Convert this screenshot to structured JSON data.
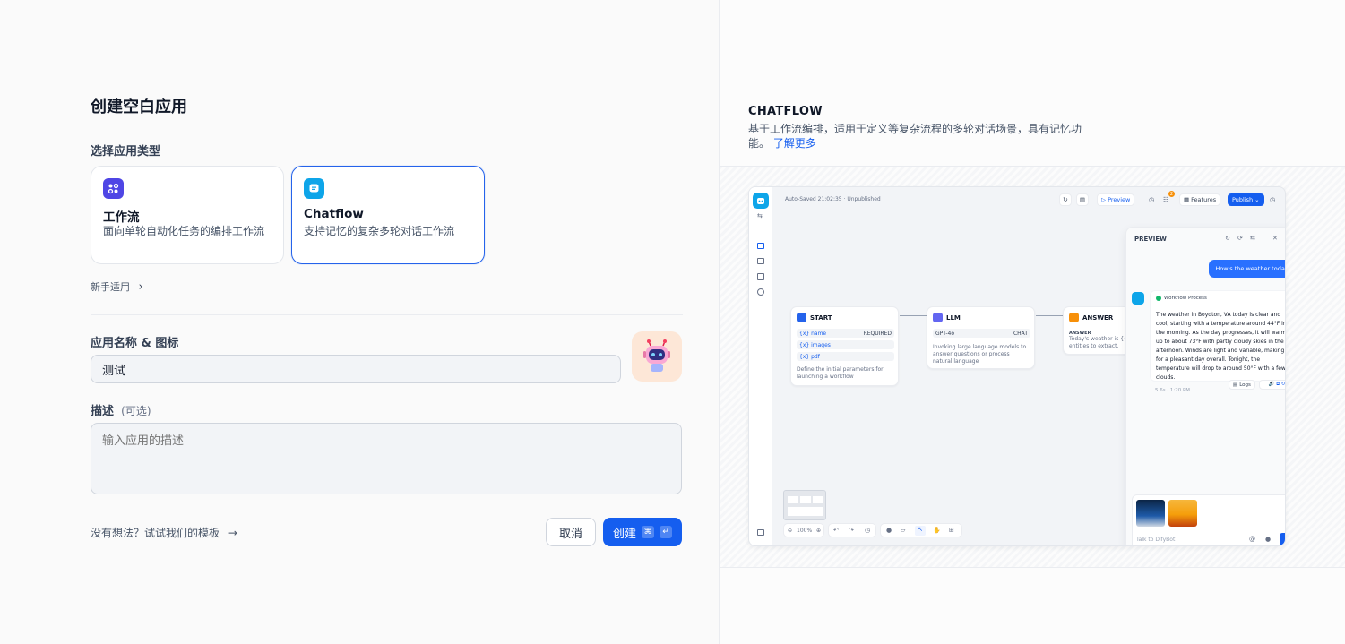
{
  "form": {
    "title": "创建空白应用",
    "type_label": "选择应用类型",
    "types": [
      {
        "name": "工作流",
        "desc": "面向单轮自动化任务的编排工作流",
        "icon": "workflow-icon",
        "color": "#4f46e5"
      },
      {
        "name": "Chatflow",
        "desc": "支持记忆的复杂多轮对话工作流",
        "icon": "chatflow-icon",
        "color": "#0ea5e9"
      }
    ],
    "newbie": "新手适用",
    "name_label": "应用名称 & 图标",
    "name_value": "测试",
    "desc_label": "描述",
    "desc_optional": "(可选)",
    "desc_placeholder": "输入应用的描述",
    "template_link": "没有想法？试试我们的模板",
    "cancel": "取消",
    "create": "创建",
    "kbd_cmd": "⌘",
    "kbd_enter": "↵"
  },
  "preview": {
    "title": "CHATFLOW",
    "desc": "基于工作流编排，适用于定义等复杂流程的多轮对话场景，具有记忆功能。",
    "learn_more": "了解更多",
    "canvas": {
      "autosave": "Auto-Saved 21:02:35 · Unpublished",
      "preview_btn": "▷ Preview",
      "features": "Features",
      "publish": "Publish",
      "badge": "2",
      "zoom": "100%",
      "start": {
        "title": "START",
        "rows": [
          {
            "k": "{x} name",
            "v": "REQUIRED"
          },
          {
            "k": "{x} images",
            "v": ""
          },
          {
            "k": "{x} pdf",
            "v": ""
          }
        ],
        "desc": "Define the initial parameters for launching a workflow"
      },
      "llm": {
        "title": "LLM",
        "model": "GPT-4o",
        "tag": "CHAT",
        "desc": "Invoking large language models to answer questions or process natural language"
      },
      "answer": {
        "title": "ANSWER",
        "sub": "ANSWER",
        "text": "Today's weather is {{w",
        "text2": "entities to extract."
      },
      "chat": {
        "title": "PREVIEW",
        "user_msg": "How's the weather today",
        "wf_label": "Workflow Process",
        "reply": "The weather in Boydton, VA today is clear and cool, starting with a temperature around 44°F in the morning. As the day progresses, it will warm up to about 73°F with partly cloudy skies in the afternoon. Winds are light and variable, making for a pleasant day overall. Tonight, the temperature will drop to around 50°F with a few clouds.",
        "meta": "5.6s · 1:20 PM",
        "logs": "Logs",
        "input_placeholder": "Talk to DifyBot"
      }
    }
  },
  "colors": {
    "primary": "#155eef",
    "border": "#eaecf0"
  }
}
